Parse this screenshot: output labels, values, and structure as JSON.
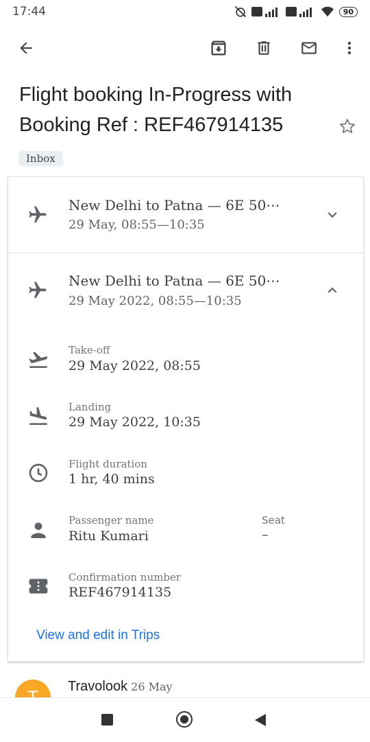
{
  "status": {
    "time": "17:44",
    "battery": "90"
  },
  "email": {
    "subject": "Flight booking In-Progress  with Booking Ref :  REF467914135",
    "label": "Inbox"
  },
  "flights": [
    {
      "title": "New Delhi to Patna — 6E 50⋯",
      "subtitle": "29 May, 08:55—10:35"
    },
    {
      "title": "New Delhi to Patna — 6E 50⋯",
      "subtitle": "29 May 2022, 08:55—10:35"
    }
  ],
  "details": {
    "takeoff_label": "Take-off",
    "takeoff_value": "29 May 2022, 08:55",
    "landing_label": "Landing",
    "landing_value": "29 May 2022, 10:35",
    "duration_label": "Flight duration",
    "duration_value": "1 hr, 40 mins",
    "passenger_label": "Passenger name",
    "passenger_value": "Ritu Kumari",
    "seat_label": "Seat",
    "seat_value": "–",
    "confirmation_label": "Confirmation number",
    "confirmation_value": "REF467914135"
  },
  "link": {
    "trips": "View and edit in Trips"
  },
  "next_message": {
    "sender": "Travolook",
    "date": "26 May",
    "avatar_letter": "T"
  },
  "colors": {
    "link": "#1a73e8",
    "avatar": "#f9a825",
    "icon": "#5f6368"
  }
}
